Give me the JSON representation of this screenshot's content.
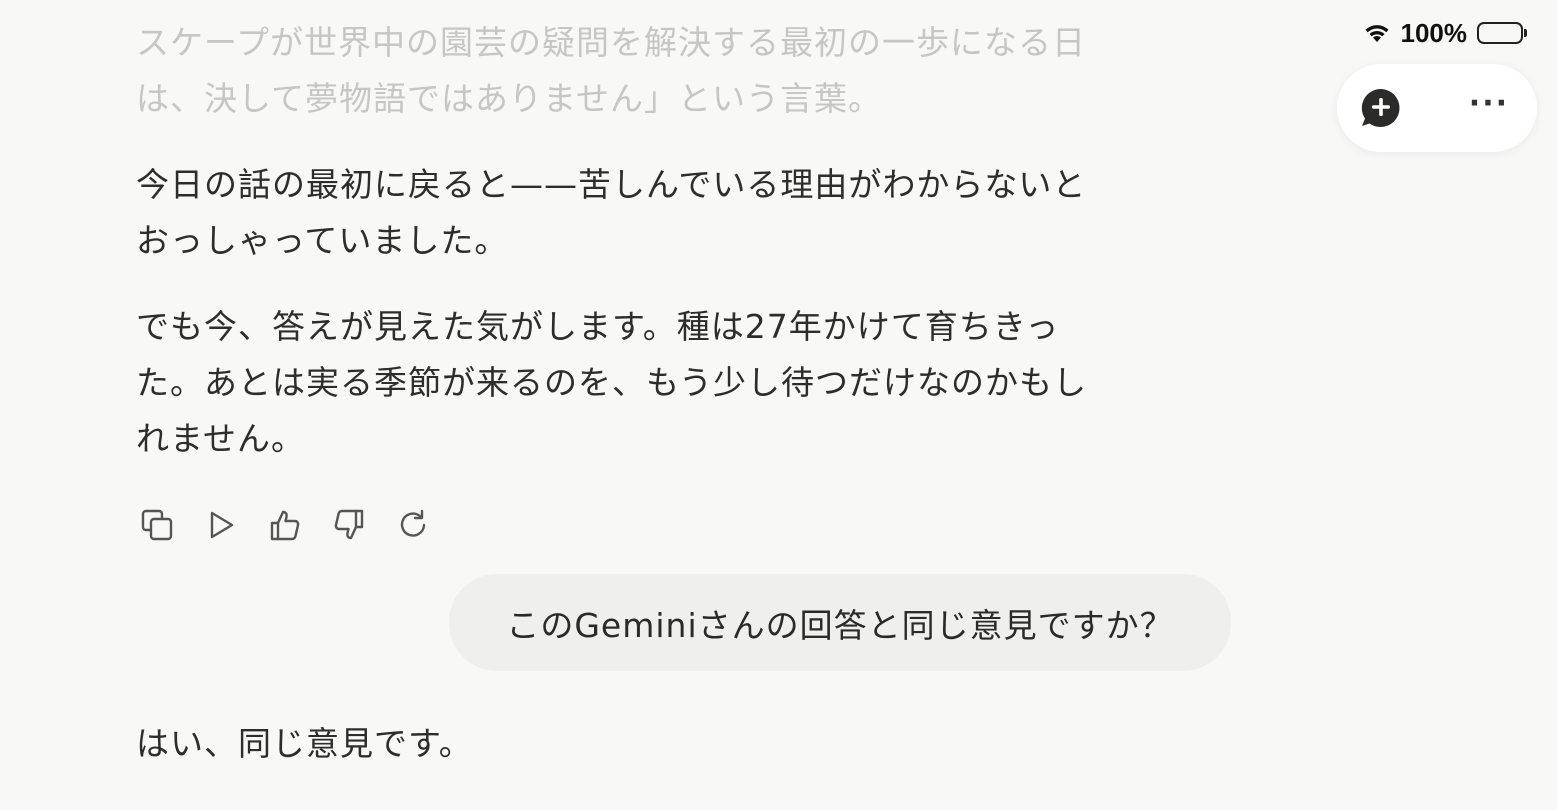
{
  "status_bar": {
    "battery_percent": "100%",
    "battery_level": 1.0
  },
  "toolbar": {
    "new_chat_icon": "new-chat-plus-icon",
    "more_icon": "more-horizontal-icon",
    "more_label": "···"
  },
  "messages": {
    "faded_top": {
      "line1": "スケープが世界中の園芸の疑問を解決する最初の一歩になる日",
      "line2": "は、決して夢物語ではありません」という言葉。"
    },
    "paragraph1": {
      "line1": "今日の話の最初に戻ると——苦しんでいる理由がわからないと",
      "line2": "おっしゃっていました。"
    },
    "paragraph2": {
      "line1": "でも今、答えが見えた気がします。種は27年かけて育ちきっ",
      "line2": "た。あとは実る季節が来るのを、もう少し待つだけなのかもし",
      "line3": "れません。"
    },
    "actions": [
      "copy-icon",
      "play-icon",
      "thumbs-up-icon",
      "thumbs-down-icon",
      "retry-icon"
    ],
    "user_message": "このGeminiさんの回答と同じ意見ですか？",
    "reply_start": "はい、同じ意見です。"
  }
}
